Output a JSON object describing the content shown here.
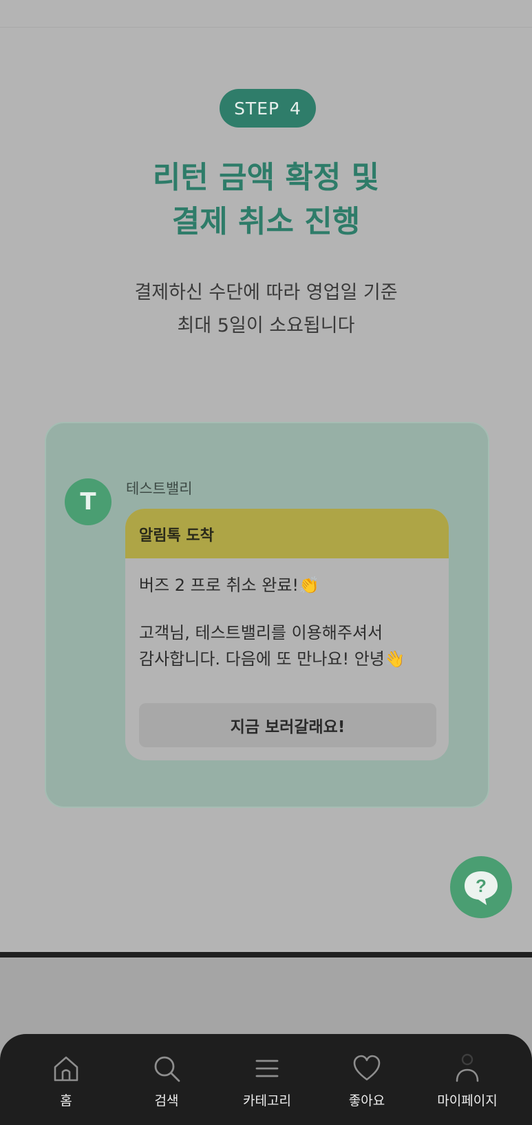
{
  "step_badge": "STEP 4",
  "headline": {
    "line1": "리턴 금액 확정 및",
    "line2": "결제 취소 진행"
  },
  "subline": {
    "line1": "결제하신 수단에 따라 영업일 기준",
    "line2": "최대 5일이 소요됩니다"
  },
  "chat": {
    "avatar_letter": "T",
    "sender_name": "테스트밸리",
    "bubble_header": "알림톡 도착",
    "message_line1": "버즈 2 프로 취소 완료!👏",
    "message_line2": "고객님, 테스트밸리를 이용해주셔서",
    "message_line3": "감사합니다. 다음에 또 만나요! 안녕👋",
    "cta_label": "지금 보러갈래요!"
  },
  "help_fab": {
    "glyph": "?",
    "icon": "help-chat-icon"
  },
  "bottom_nav": {
    "items": [
      {
        "label": "홈",
        "icon": "home-icon"
      },
      {
        "label": "검색",
        "icon": "search-icon"
      },
      {
        "label": "카테고리",
        "icon": "menu-icon"
      },
      {
        "label": "좋아요",
        "icon": "heart-icon"
      },
      {
        "label": "마이페이지",
        "icon": "user-icon"
      }
    ]
  },
  "colors": {
    "brand_green": "#2f7d6a",
    "avatar_green": "#4a9e72",
    "notice_yellow": "#aea546"
  }
}
